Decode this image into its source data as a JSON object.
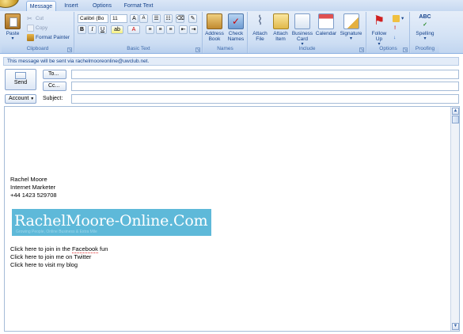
{
  "tabs": [
    {
      "label": "Message",
      "active": true
    },
    {
      "label": "Insert",
      "active": false
    },
    {
      "label": "Options",
      "active": false
    },
    {
      "label": "Format Text",
      "active": false
    }
  ],
  "ribbon": {
    "clipboard": {
      "label": "Clipboard",
      "paste": "Paste",
      "cut": "Cut",
      "copy": "Copy",
      "format_painter": "Format Painter"
    },
    "basic_text": {
      "label": "Basic Text",
      "font": "Calibri (Bo",
      "size": "11"
    },
    "names": {
      "label": "Names",
      "address_book": "Address Book",
      "check_names": "Check Names"
    },
    "include": {
      "label": "Include",
      "attach_file": "Attach File",
      "attach_item": "Attach Item",
      "business_card": "Business Card",
      "calendar": "Calendar",
      "signature": "Signature"
    },
    "options": {
      "label": "Options",
      "follow_up": "Follow Up"
    },
    "proofing": {
      "label": "Proofing",
      "spelling": "Spelling"
    }
  },
  "infobar": "This message will be sent via rachelmooreonline@uwclub.net.",
  "header": {
    "send": "Send",
    "to": "To...",
    "cc": "Cc...",
    "account": "Account",
    "subject": "Subject:"
  },
  "body": {
    "signature_name": "Rachel Moore",
    "signature_title": "Internet Marketer",
    "signature_phone": "+44 1423 529708",
    "banner_title": "RachelMoore-Online.Com",
    "banner_sub": "Growing People, Online Business & Extra Mile",
    "facebook_pre": "Click here to join in the ",
    "facebook_word": "Facebook",
    "facebook_post": " fun",
    "twitter_link": "Click here to join me on Twitter",
    "blog_link": "Click here to visit my blog"
  },
  "colors": {
    "ribbon": "#d3e2f5",
    "banner": "#5eb9d9",
    "accent": "#15428b"
  }
}
